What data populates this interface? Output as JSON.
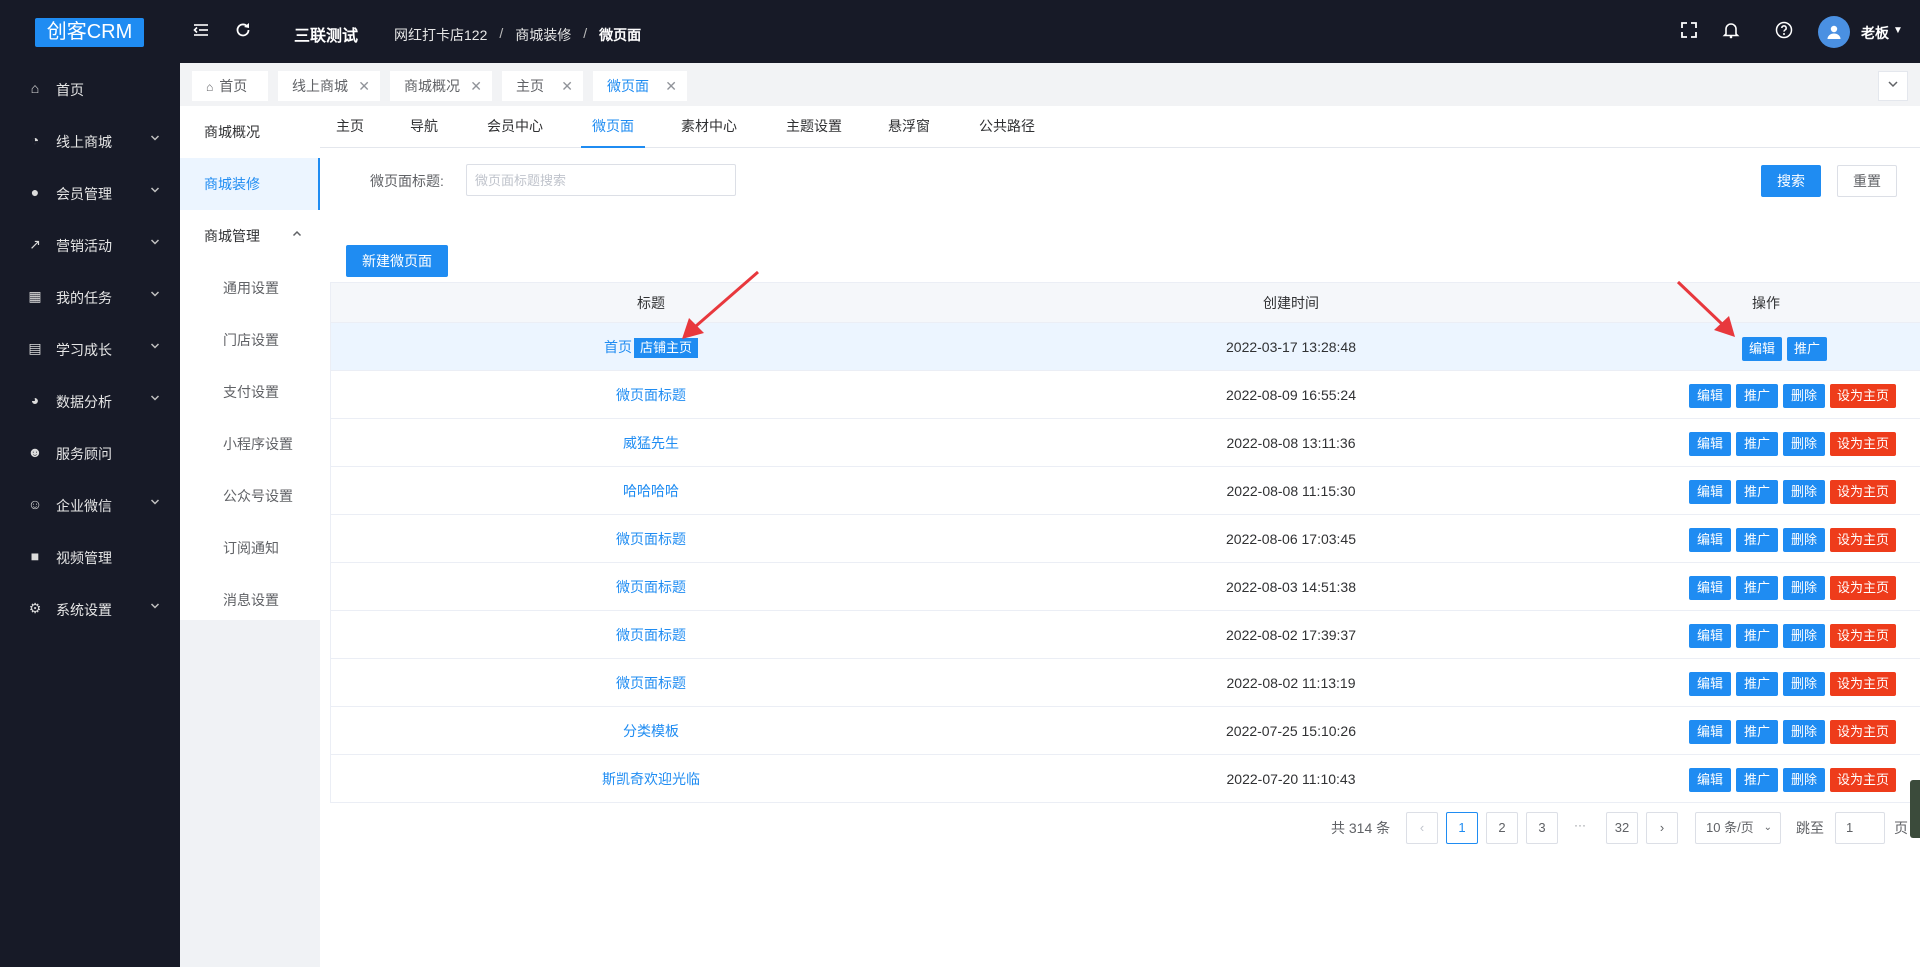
{
  "header": {
    "logo": "创客CRM",
    "system_name": "三联测试",
    "breadcrumb": [
      "网红打卡店122",
      "商城装修",
      "微页面"
    ],
    "breadcrumb_sep": "/",
    "user_name": "老板"
  },
  "sidebar": {
    "items": [
      {
        "label": "首页",
        "icon": "home-icon",
        "glyph": "⌂",
        "has_arrow": false
      },
      {
        "label": "线上商城",
        "icon": "store-icon",
        "glyph": "◔",
        "has_arrow": true
      },
      {
        "label": "会员管理",
        "icon": "user-icon",
        "glyph": "●",
        "has_arrow": true
      },
      {
        "label": "营销活动",
        "icon": "trend-icon",
        "glyph": "↗",
        "has_arrow": true
      },
      {
        "label": "我的任务",
        "icon": "grid-icon",
        "glyph": "▦",
        "has_arrow": true
      },
      {
        "label": "学习成长",
        "icon": "book-icon",
        "glyph": "▤",
        "has_arrow": true
      },
      {
        "label": "数据分析",
        "icon": "pie-icon",
        "glyph": "◕",
        "has_arrow": true
      },
      {
        "label": "服务顾问",
        "icon": "team-icon",
        "glyph": "☻",
        "has_arrow": false
      },
      {
        "label": "企业微信",
        "icon": "group-icon",
        "glyph": "☺",
        "has_arrow": true
      },
      {
        "label": "视频管理",
        "icon": "video-icon",
        "glyph": "■",
        "has_arrow": false
      },
      {
        "label": "系统设置",
        "icon": "gear-icon",
        "glyph": "⚙",
        "has_arrow": true
      }
    ]
  },
  "tags": {
    "items": [
      {
        "label": "首页",
        "closable": false
      },
      {
        "label": "线上商城",
        "closable": true
      },
      {
        "label": "商城概况",
        "closable": true
      },
      {
        "label": "主页",
        "closable": true
      },
      {
        "label": "微页面",
        "closable": true
      }
    ],
    "close_glyph": "✕"
  },
  "submenu": {
    "items": [
      "商城概况",
      "商城装修",
      "商城管理",
      "通用设置",
      "门店设置",
      "支付设置",
      "小程序设置",
      "公众号设置",
      "订阅通知",
      "消息设置"
    ]
  },
  "navtabs": [
    "主页",
    "导航",
    "会员中心",
    "微页面",
    "素材中心",
    "主题设置",
    "悬浮窗",
    "公共路径"
  ],
  "search": {
    "label": "微页面标题:",
    "placeholder": "微页面标题搜索",
    "value": "",
    "search_button": "搜索",
    "reset_button": "重置"
  },
  "new_button": "新建微页面",
  "table": {
    "columns": [
      "标题",
      "创建时间",
      "操作"
    ],
    "first_row_badge": "店铺主页",
    "rows": [
      {
        "title": "首页",
        "created": "2022-03-17 13:28:48"
      },
      {
        "title": "微页面标题",
        "created": "2022-08-09 16:55:24"
      },
      {
        "title": "威猛先生",
        "created": "2022-08-08 13:11:36"
      },
      {
        "title": "哈哈哈哈",
        "created": "2022-08-08 11:15:30"
      },
      {
        "title": "微页面标题",
        "created": "2022-08-06 17:03:45"
      },
      {
        "title": "微页面标题",
        "created": "2022-08-03 14:51:38"
      },
      {
        "title": "微页面标题",
        "created": "2022-08-02 17:39:37"
      },
      {
        "title": "微页面标题",
        "created": "2022-08-02 11:13:19"
      },
      {
        "title": "分类模板",
        "created": "2022-07-25 15:10:26"
      },
      {
        "title": "斯凯奇欢迎光临",
        "created": "2022-07-20 11:10:43"
      }
    ],
    "actions": {
      "edit": "编辑",
      "promote": "推广",
      "delete": "删除",
      "set_home": "设为主页"
    }
  },
  "pagination": {
    "total_text": "共 314 条",
    "pages": [
      "1",
      "2",
      "3",
      "32"
    ],
    "current": "1",
    "ellipsis": "···",
    "page_size": "10 条/页",
    "jump_label": "跳至",
    "jump_value": "1",
    "page_suffix": "页"
  },
  "colors": {
    "primary": "#1f8cf2",
    "danger": "#ee3c1b",
    "sidebar": "#171a27",
    "annotation": "#e8383d"
  }
}
